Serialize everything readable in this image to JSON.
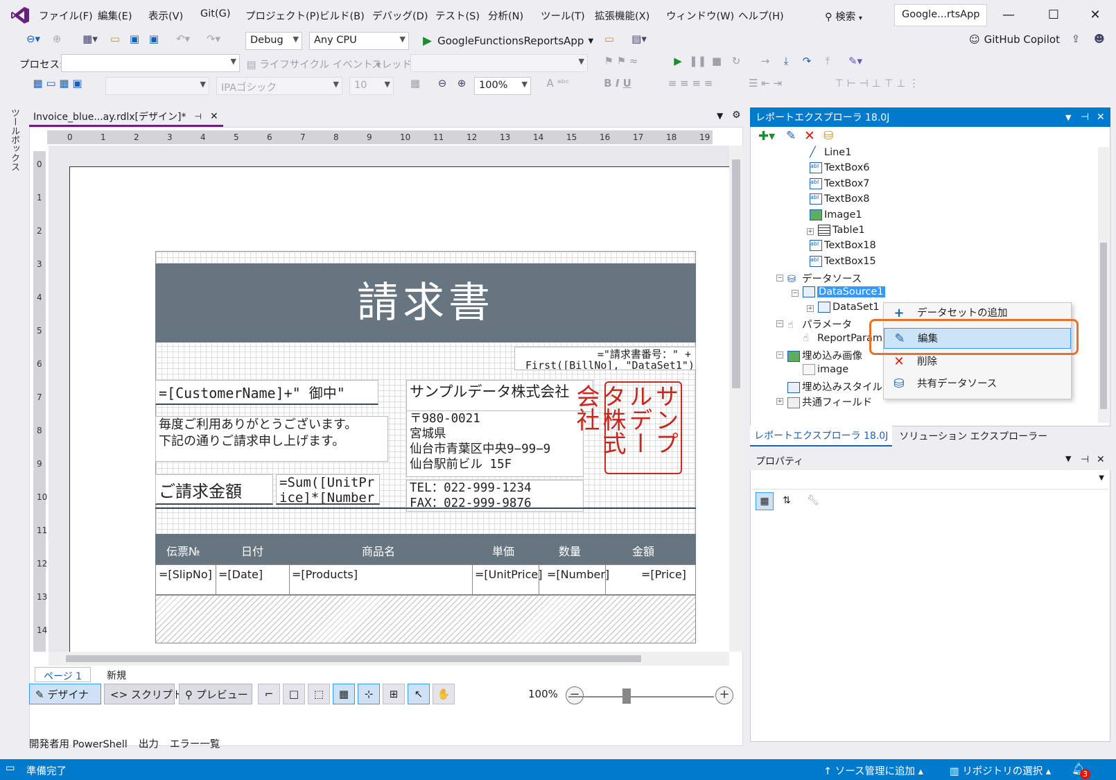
{
  "menu": {
    "items": [
      "ファイル(F)",
      "編集(E)",
      "表示(V)",
      "Git(G)",
      "プロジェクト(P)",
      "ビルド(B)",
      "デバッグ(D)",
      "テスト(S)",
      "分析(N)",
      "ツール(T)",
      "拡張機能(X)",
      "ウィンドウ(W)",
      "ヘルプ(H)"
    ],
    "search_label": "検索",
    "window_title": "Google...rtsApp"
  },
  "toolbar1": {
    "config": "Debug",
    "platform": "Any CPU",
    "run_target": "GoogleFunctionsReportsApp",
    "copilot_label": "GitHub Copilot"
  },
  "toolbar2": {
    "process_label": "プロセス:",
    "lifecycle_label": "ライフサイクル イベント",
    "thread_label": "スレッド:"
  },
  "toolbar3": {
    "font": "IPAゴシック",
    "font_size": "10",
    "zoom": "100%"
  },
  "toolbox_label": "ツールボックス",
  "document": {
    "tab_title": "Invoice_blue...ay.rdlx[デザイン]*",
    "ruler_h": [
      "0",
      "1",
      "2",
      "3",
      "4",
      "5",
      "6",
      "7",
      "8",
      "9",
      "10",
      "11",
      "12",
      "13",
      "14",
      "15",
      "16",
      "17",
      "18",
      "19"
    ],
    "ruler_v": [
      "0",
      "1",
      "2",
      "3",
      "4",
      "5",
      "6",
      "7",
      "8",
      "9",
      "10",
      "11",
      "12",
      "13",
      "14"
    ]
  },
  "report": {
    "title": "請求書",
    "bill_no_expr": "=\"請求書番号：\" +\n First([BillNo], \"DataSet1\")",
    "customer_expr": "=[CustomerName]+\" 御中\"",
    "greeting": "毎度ご利用ありがとうございます。\n下記の通りご請求申し上げます。",
    "company_name": "サンプルデータ株式会社",
    "address": "〒980-0021\n宮城県\n仙台市青葉区中央9−99−9\n仙台駅前ビル 15F",
    "phone": "TEL：022-999-1234\nFAX：022-999-9876",
    "amount_label": "ご請求金額",
    "amount_expr": "=Sum([UnitPr\nice]*[Number",
    "stamp_text": "サンプルデータ株式会社",
    "table_headers": [
      "伝票№",
      "日付",
      "商品名",
      "単価",
      "数量",
      "金額"
    ],
    "table_cells": [
      "=[SlipNo]",
      "=[Date]",
      "=[Products]",
      "=[UnitPrice]",
      "=[Number]",
      "=[Price]"
    ]
  },
  "bottom": {
    "page_tab": "ページ 1",
    "new_tab": "新規",
    "designer": "デザイナ",
    "script": "スクリプト",
    "preview": "プレビュー",
    "zoom": "100%"
  },
  "tool_tabs": [
    "開発者用 PowerShell",
    "出力",
    "エラー一覧"
  ],
  "status": {
    "ready": "準備完了",
    "add_source": "ソース管理に追加",
    "select_repo": "リポジトリの選択",
    "notif_count": "3"
  },
  "report_explorer": {
    "title": "レポートエクスプローラ 18.0J",
    "tree": {
      "line1": "Line1",
      "textbox6": "TextBox6",
      "textbox7": "TextBox7",
      "textbox8": "TextBox8",
      "image1": "Image1",
      "table1": "Table1",
      "textbox18": "TextBox18",
      "textbox15": "TextBox15",
      "datasources": "データソース",
      "datasource1": "DataSource1",
      "dataset1": "DataSet1",
      "parameters": "パラメータ",
      "reportparam": "ReportParam",
      "embedded_images": "埋め込み画像",
      "image": "image",
      "embedded_styles": "埋め込みスタイル",
      "common_fields": "共通フィールド"
    },
    "context_menu": [
      "データセットの追加",
      "編集",
      "削除",
      "共有データソース"
    ],
    "tabs": [
      "レポートエクスプローラ 18.0J",
      "ソリューション エクスプローラー"
    ]
  },
  "properties": {
    "title": "プロパティ"
  },
  "colors": {
    "accent": "#007acc",
    "band": "#677581",
    "stamp": "#c8271d",
    "highlight": "#e8712a"
  }
}
